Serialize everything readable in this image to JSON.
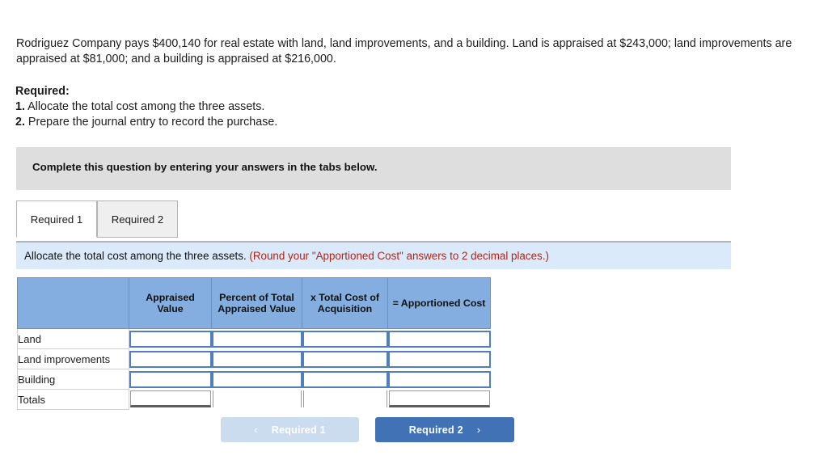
{
  "problem": {
    "statement": "Rodriguez Company pays $400,140 for real estate with land, land improvements, and a building. Land is appraised at $243,000; land improvements are appraised at $81,000; and a building is appraised at $216,000."
  },
  "required": {
    "heading": "Required:",
    "items": [
      {
        "num": "1.",
        "text": "Allocate the total cost among the three assets."
      },
      {
        "num": "2.",
        "text": "Prepare the journal entry to record the purchase."
      }
    ]
  },
  "banner": {
    "text": "Complete this question by entering your answers in the tabs below."
  },
  "tabs": [
    {
      "label": "Required 1",
      "active": true
    },
    {
      "label": "Required 2",
      "active": false
    }
  ],
  "hint": {
    "main": "Allocate the total cost among the three assets.",
    "note": "(Round your \"Apportioned Cost\" answers to 2 decimal places.)",
    "note_color": "#b02418"
  },
  "table": {
    "headers": [
      "",
      "Appraised Value",
      "Percent of Total Appraised Value",
      "x Total Cost of Acquisition",
      "= Apportioned Cost"
    ],
    "header_bg": "#85aee0",
    "rows": [
      {
        "label": "Land",
        "type": "input",
        "values": [
          "",
          "",
          "",
          ""
        ]
      },
      {
        "label": "Land improvements",
        "type": "input",
        "values": [
          "",
          "",
          "",
          ""
        ]
      },
      {
        "label": "Building",
        "type": "input",
        "values": [
          "",
          "",
          "",
          ""
        ]
      },
      {
        "label": "Totals",
        "type": "total",
        "values": [
          "",
          "",
          "",
          ""
        ]
      }
    ]
  },
  "nav": {
    "prev": {
      "label": "Required 1",
      "icon": "chevron-left",
      "glyph": "‹",
      "disabled": true,
      "bg": "#ccdcef"
    },
    "next": {
      "label": "Required 2",
      "icon": "chevron-right",
      "glyph": "›",
      "disabled": false,
      "bg": "#4272b6"
    }
  }
}
